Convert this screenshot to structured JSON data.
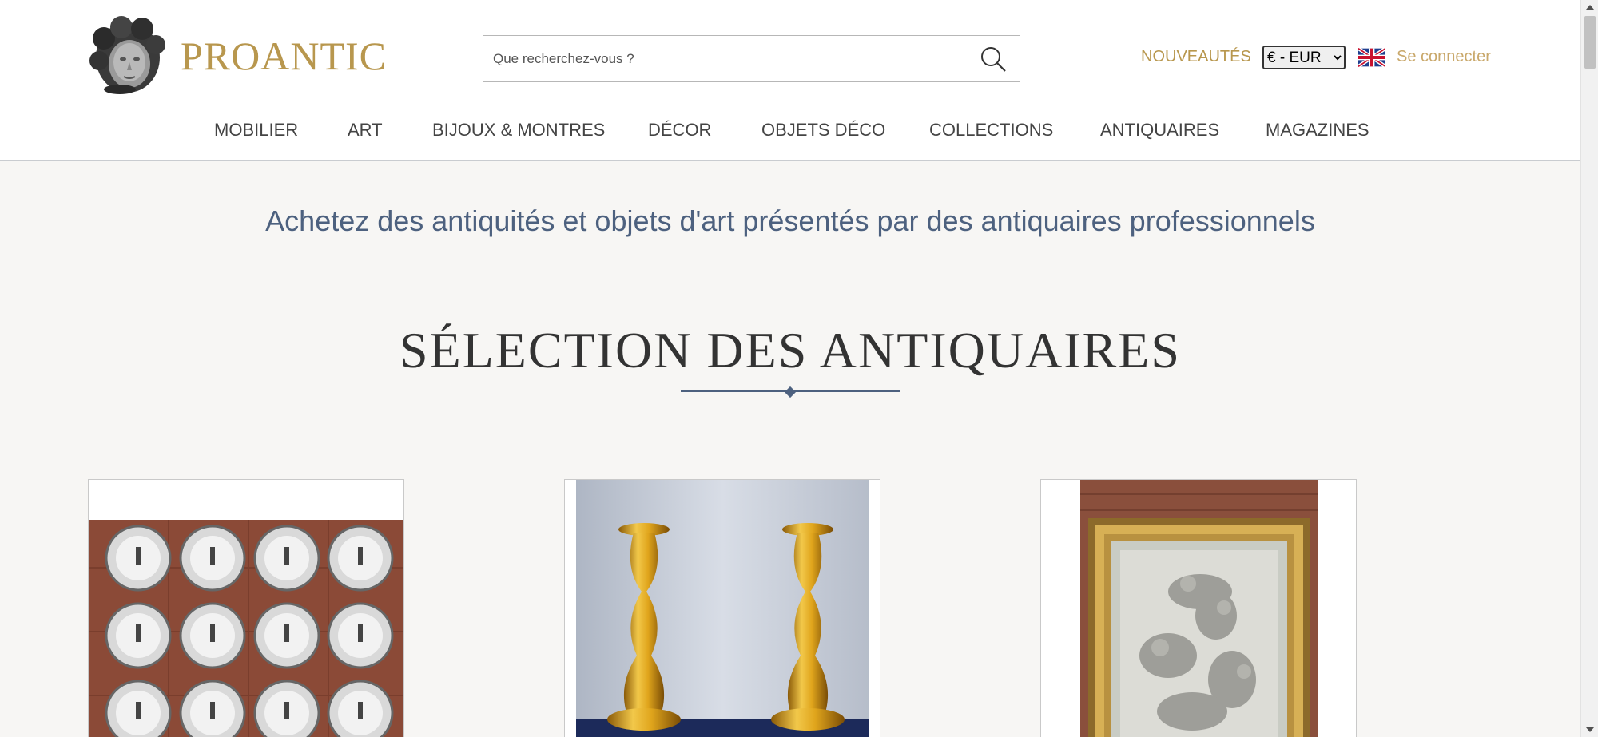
{
  "header": {
    "logo_text": "PROANTIC",
    "search_placeholder": "Que recherchez-vous ?",
    "nouveautes": "NOUVEAUTÉS",
    "currency_selected": "€ - EUR",
    "login": "Se connecter"
  },
  "nav": {
    "items": [
      "MOBILIER",
      "ART",
      "BIJOUX & MONTRES",
      "DÉCOR",
      "OBJETS DÉCO",
      "COLLECTIONS",
      "ANTIQUAIRES",
      "MAGAZINES"
    ]
  },
  "main": {
    "tagline": "Achetez des antiquités et objets d'art présentés par des antiquaires professionnels",
    "section_title": "SÉLECTION DES ANTIQUAIRES"
  },
  "cards": [
    {
      "icon": "plates-image"
    },
    {
      "icon": "candlesticks-image"
    },
    {
      "icon": "framed-drawing-image"
    }
  ],
  "colors": {
    "brand_gold": "#b8974e",
    "tagline_blue": "#4d617f",
    "nav_text": "#444444"
  }
}
